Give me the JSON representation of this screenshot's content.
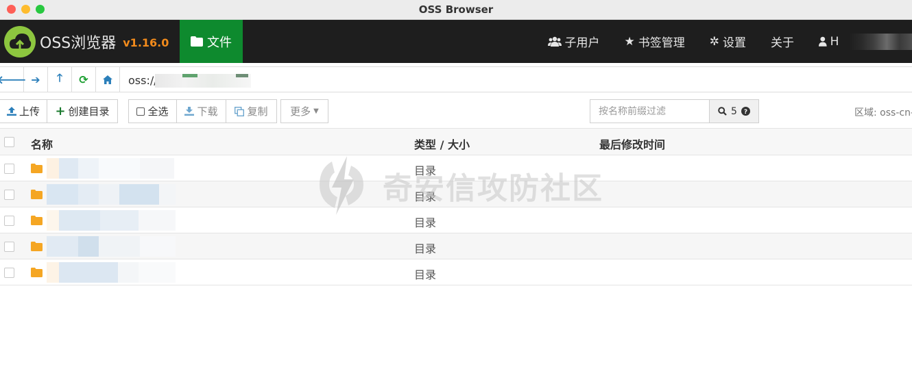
{
  "window": {
    "title": "OSS Browser"
  },
  "app": {
    "name": "OSS浏览器",
    "version": "v1.16.0"
  },
  "header": {
    "tab_files": "文件",
    "nav": {
      "subuser": "子用户",
      "bookmarks": "书签管理",
      "settings": "设置",
      "about": "关于",
      "user": "H"
    }
  },
  "address": {
    "value": "oss://"
  },
  "toolbar": {
    "upload": "上传",
    "mkdir": "创建目录",
    "select_all": "全选",
    "download": "下载",
    "copy": "复制",
    "more": "更多",
    "filter_placeholder": "按名称前缀过滤",
    "filter_count": "5",
    "region": "区域: oss-cn-h"
  },
  "table": {
    "headers": {
      "name": "名称",
      "type": "类型 / 大小",
      "modified": "最后修改时间"
    },
    "rows": [
      {
        "type": "目录"
      },
      {
        "type": "目录"
      },
      {
        "type": "目录"
      },
      {
        "type": "目录"
      },
      {
        "type": "目录"
      }
    ]
  },
  "watermark": {
    "text": "奇安信攻防社区"
  },
  "colors": {
    "header_bg": "#1e1e1e",
    "active_tab": "#0e8a2e",
    "version": "#f28b1c",
    "folder": "#f5a623",
    "link_icon": "#2b7fba"
  }
}
